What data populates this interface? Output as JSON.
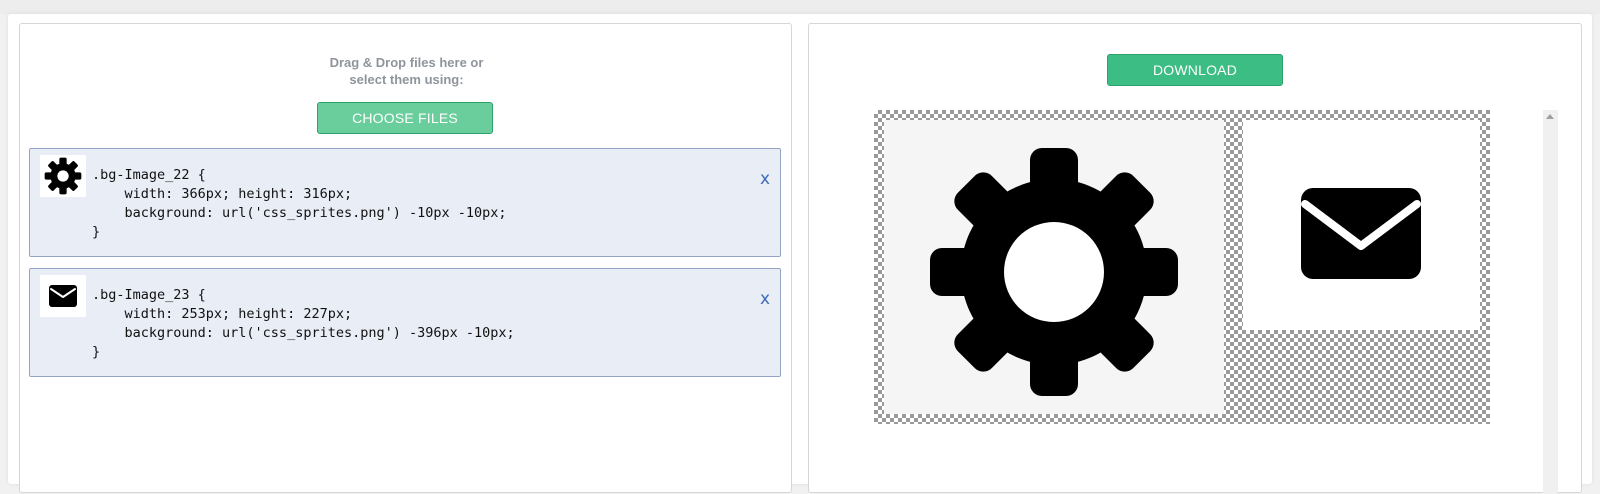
{
  "upload": {
    "drag_line1": "Drag & Drop files here or",
    "drag_line2": "select them using:",
    "choose_label": "CHOOSE FILES"
  },
  "items": [
    {
      "icon": "gear-icon",
      "code": ".bg-Image_22 {\n    width: 366px; height: 316px;\n    background: url('css_sprites.png') -10px -10px;\n}",
      "close": "x"
    },
    {
      "icon": "envelope-icon",
      "code": ".bg-Image_23 {\n    width: 253px; height: 227px;\n    background: url('css_sprites.png') -396px -10px;\n}",
      "close": "x"
    }
  ],
  "output": {
    "download_label": "DOWNLOAD"
  },
  "colors": {
    "choose_button": "#69cd9c",
    "download_button": "#3cbd83",
    "item_background": "#e9edf5",
    "item_border": "#93a4c7",
    "close_x": "#3f6bb8"
  }
}
